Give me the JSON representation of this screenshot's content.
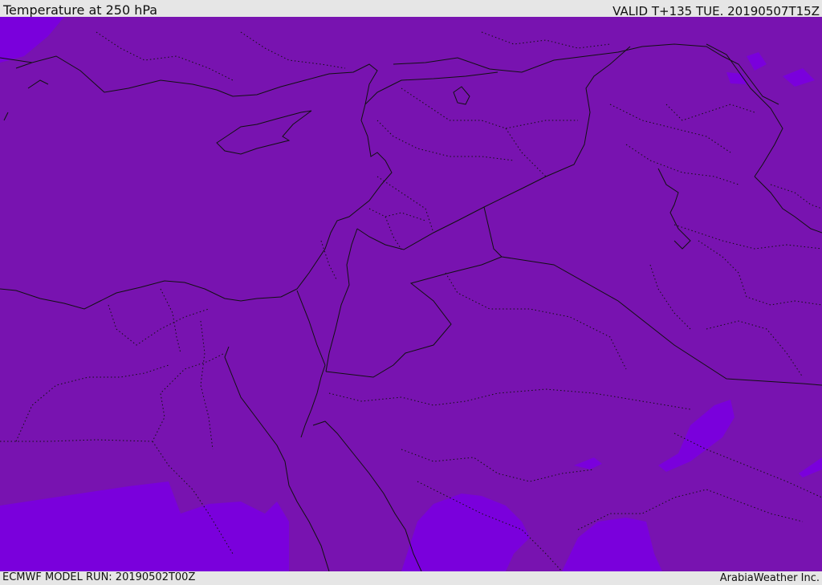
{
  "header": {
    "title": "Temperature at 250 hPa",
    "valid": "VALID T+135 TUE. 20190507T15Z"
  },
  "footer": {
    "model_run": "ECMWF MODEL RUN: 20190502T00Z",
    "credit": "ArabiaWeather Inc."
  },
  "map": {
    "field": "temperature",
    "level": "250 hPa",
    "colors": {
      "base": "#7813b0",
      "colder": "#7a00dc",
      "coastline": "#111111",
      "border": "#111111"
    }
  }
}
